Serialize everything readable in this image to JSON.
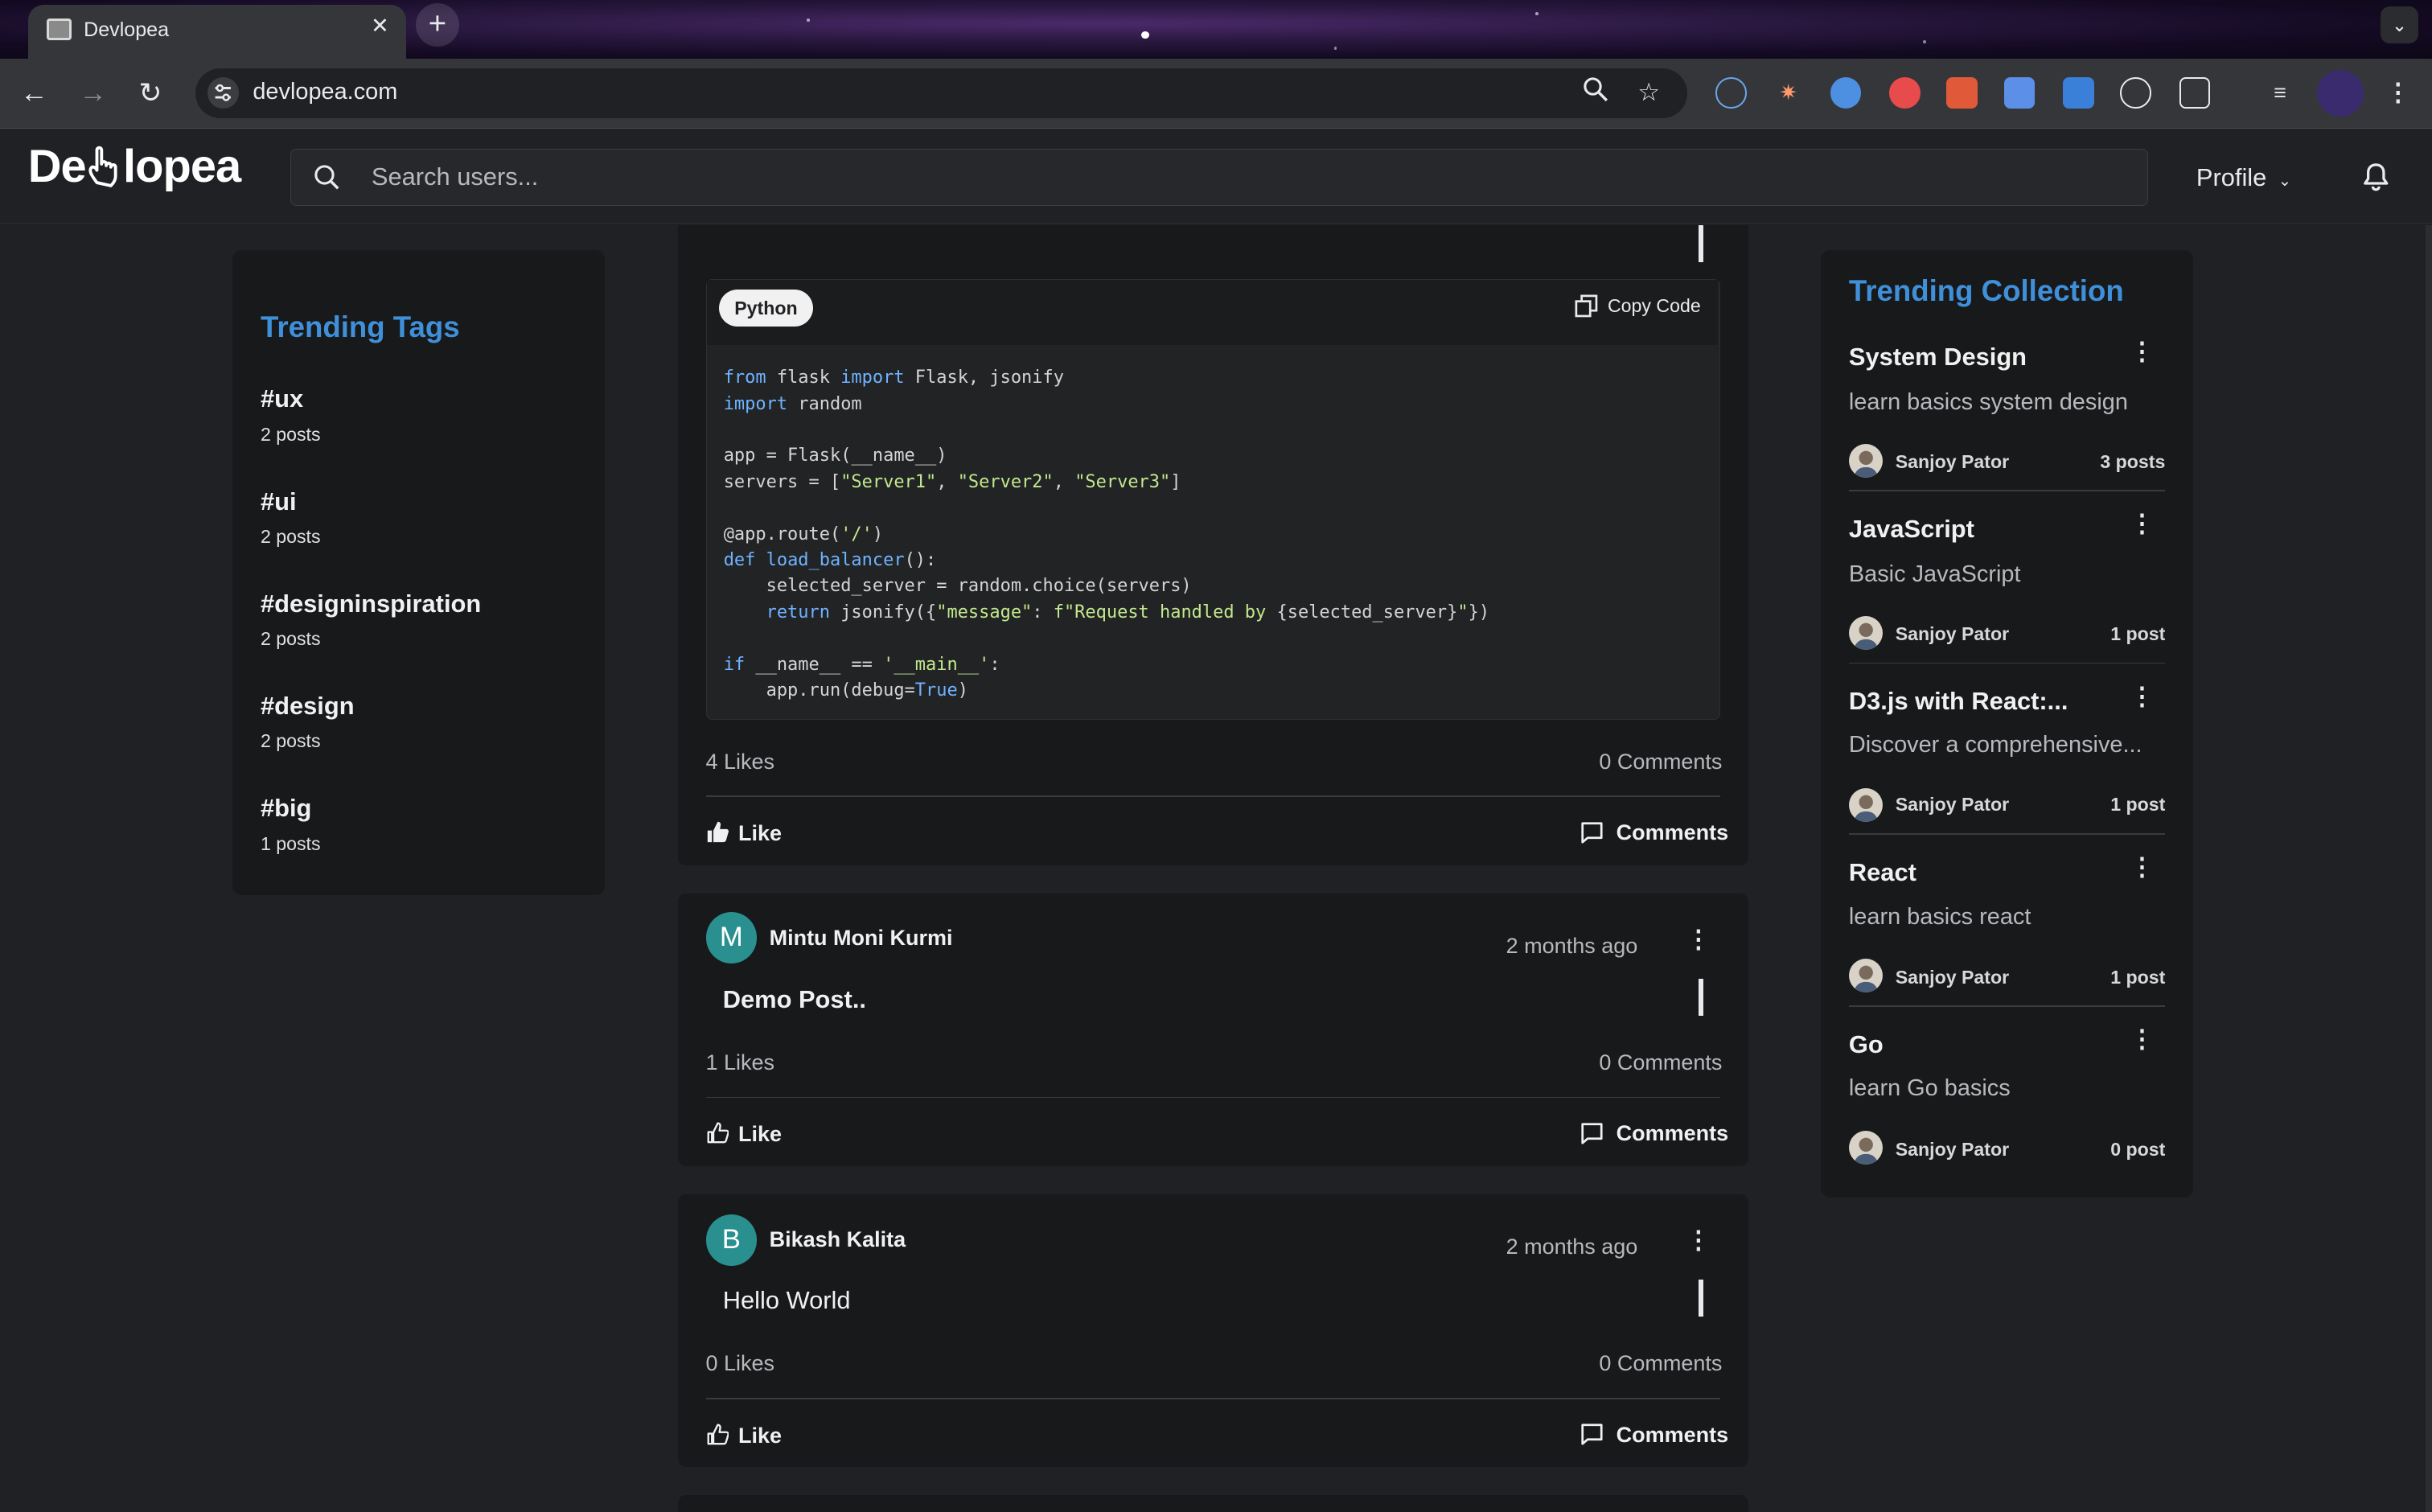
{
  "browser": {
    "tab_title": "Devlopea",
    "url": "devlopea.com"
  },
  "header": {
    "logo_pre": "De",
    "logo_post": "lopea",
    "search_placeholder": "Search users...",
    "profile_label": "Profile"
  },
  "trending_tags": {
    "title": "Trending Tags",
    "items": [
      {
        "name": "#ux",
        "count": "2 posts"
      },
      {
        "name": "#ui",
        "count": "2 posts"
      },
      {
        "name": "#designinspiration",
        "count": "2 posts"
      },
      {
        "name": "#design",
        "count": "2 posts"
      },
      {
        "name": "#big",
        "count": "1 posts"
      }
    ]
  },
  "code_post": {
    "language": "Python",
    "copy_label": "Copy Code",
    "likes": "4 Likes",
    "comments": "0 Comments",
    "like_label": "Like",
    "comments_label": "Comments"
  },
  "posts": [
    {
      "avatar_letter": "M",
      "author": "Mintu Moni Kurmi",
      "time": "2 months ago",
      "title": "Demo Post..",
      "likes": "1 Likes",
      "comments": "0 Comments",
      "like_label": "Like",
      "comments_label": "Comments"
    },
    {
      "avatar_letter": "B",
      "author": "Bikash Kalita",
      "time": "2 months ago",
      "title": "Hello World",
      "likes": "0 Likes",
      "comments": "0 Comments",
      "like_label": "Like",
      "comments_label": "Comments"
    }
  ],
  "trending_collection": {
    "title": "Trending Collection",
    "items": [
      {
        "name": "System Design",
        "desc": "learn basics system design",
        "author": "Sanjoy Pator",
        "count": "3 posts"
      },
      {
        "name": "JavaScript",
        "desc": "Basic JavaScript",
        "author": "Sanjoy Pator",
        "count": "1 post"
      },
      {
        "name": "D3.js with React:...",
        "desc": "Discover a comprehensive...",
        "author": "Sanjoy Pator",
        "count": "1 post"
      },
      {
        "name": "React",
        "desc": "learn basics react",
        "author": "Sanjoy Pator",
        "count": "1 post"
      },
      {
        "name": "Go",
        "desc": "learn Go basics",
        "author": "Sanjoy Pator",
        "count": "0 post"
      }
    ]
  },
  "colors": {
    "accent": "#3f8fd9",
    "avatar": "#2a8f8f",
    "background": "#202124",
    "card": "#18191b"
  }
}
